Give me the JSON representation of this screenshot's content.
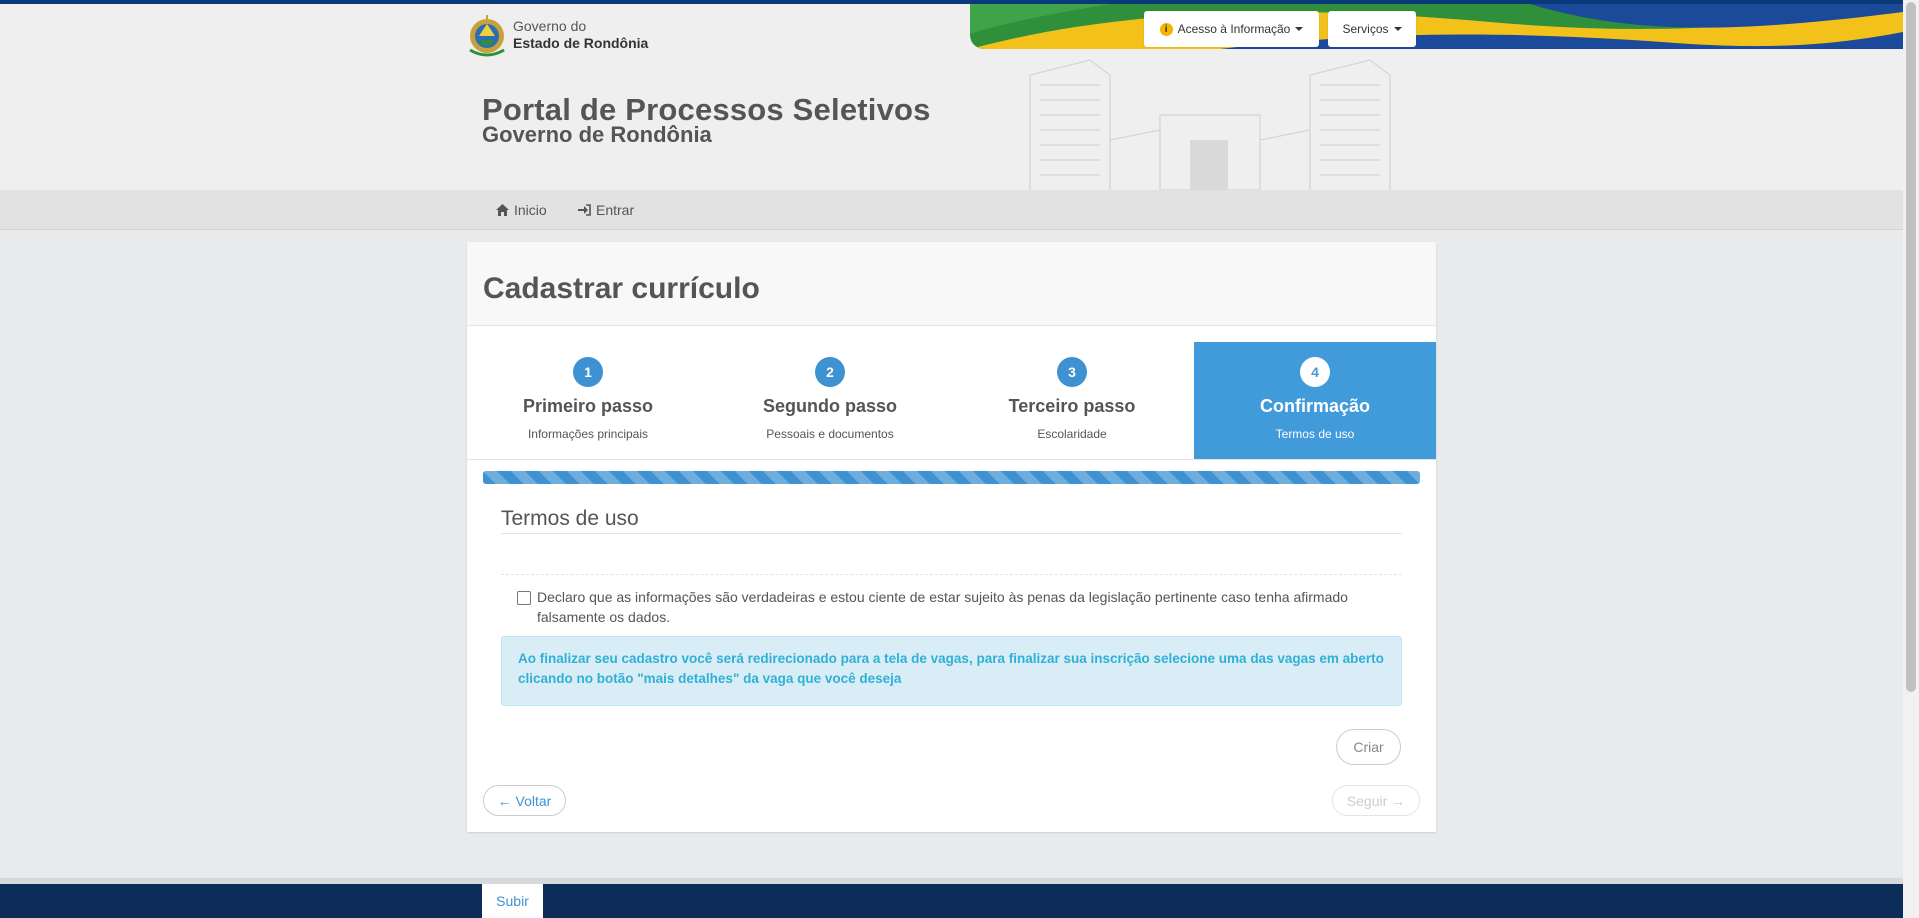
{
  "header": {
    "logo_line1": "Governo do",
    "logo_line2": "Estado de Rondônia",
    "access_button": "Acesso à Informação",
    "services_button": "Serviços",
    "portal_title": "Portal de Processos Seletivos",
    "portal_subtitle": "Governo de Rondônia"
  },
  "nav": {
    "home": "Inicio",
    "login": "Entrar"
  },
  "page": {
    "title": "Cadastrar currículo"
  },
  "steps": [
    {
      "number": "1",
      "title": "Primeiro passo",
      "subtitle": "Informações principais"
    },
    {
      "number": "2",
      "title": "Segundo passo",
      "subtitle": "Pessoais e documentos"
    },
    {
      "number": "3",
      "title": "Terceiro passo",
      "subtitle": "Escolaridade"
    },
    {
      "number": "4",
      "title": "Confirmação",
      "subtitle": "Termos de uso",
      "active": true
    }
  ],
  "progress": 1.0,
  "terms": {
    "heading": "Termos de uso",
    "checkbox_label": "Declaro que as informações são verdadeiras e estou ciente de estar sujeito às penas da legislação pertinente caso tenha afirmado falsamente os dados.",
    "checked": false,
    "alert": "Ao finalizar seu cadastro você será redirecionado para a tela de vagas, para finalizar sua inscrição selecione uma das vagas em aberto clicando no botão \"mais detalhes\" da vaga que você deseja"
  },
  "buttons": {
    "create": "Criar",
    "back": "← Voltar",
    "next": "Seguir →"
  },
  "footer": {
    "top_link": "Subir"
  },
  "colors": {
    "primary": "#419ada",
    "footer": "#0c2c5a",
    "alert_text": "#31b0d5"
  }
}
